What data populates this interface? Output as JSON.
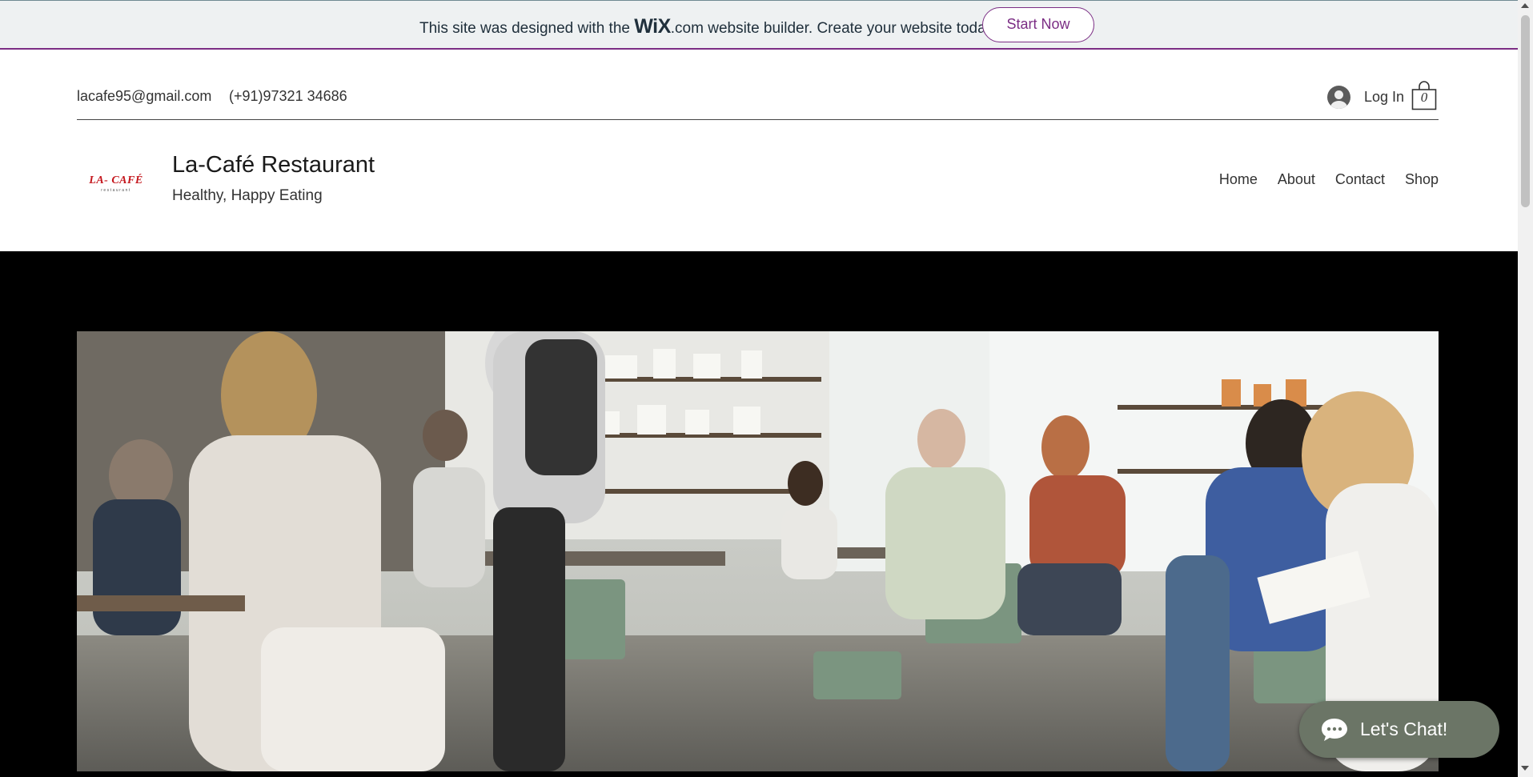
{
  "banner": {
    "text_before": "This site was designed with the ",
    "wix_logo": "WiX",
    "wix_tld": ".com",
    "text_after": " website builder. Create your website today.",
    "button_label": "Start Now",
    "accent": "#7b2d84"
  },
  "contact": {
    "email": "lacafe95@gmail.com",
    "phone": "(+91)97321 34686"
  },
  "account": {
    "login_label": "Log In",
    "cart_count": "0"
  },
  "header": {
    "logo_text": "LA- CAFÉ",
    "logo_subtext": "restaurant",
    "title": "La-Café Restaurant",
    "tagline": "Healthy, Happy Eating"
  },
  "nav": {
    "items": [
      "Home",
      "About",
      "Contact",
      "Shop"
    ]
  },
  "hero": {
    "image": "cafe-interior-photo"
  },
  "chat": {
    "label": "Let's Chat!",
    "color": "#6b7566"
  }
}
